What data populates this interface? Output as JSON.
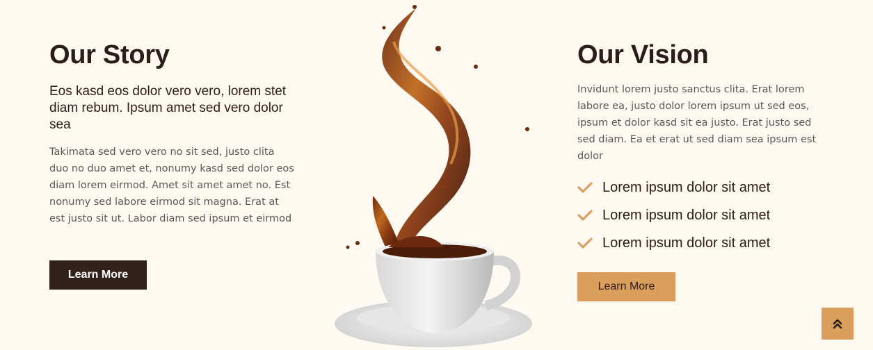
{
  "story": {
    "title": "Our Story",
    "lead": "Eos kasd eos dolor vero vero, lorem stet diam rebum. Ipsum amet sed vero dolor sea",
    "body": "Takimata sed vero vero no sit sed, justo clita duo no duo amet et, nonumy kasd sed dolor eos diam lorem eirmod. Amet sit amet amet no. Est nonumy sed labore eirmod sit magna. Erat at est justo sit ut. Labor diam sed ipsum et eirmod",
    "button_label": "Learn More"
  },
  "vision": {
    "title": "Our Vision",
    "body": "Invidunt lorem justo sanctus clita. Erat lorem labore ea, justo dolor lorem ipsum ut sed eos, ipsum et dolor kasd sit ea justo. Erat justo sed sed diam. Ea et erat ut sed diam sea ipsum est dolor",
    "features": [
      "Lorem ipsum dolor sit amet",
      "Lorem ipsum dolor sit amet",
      "Lorem ipsum dolor sit amet"
    ],
    "button_label": "Learn More"
  },
  "icons": {
    "feature_icon": "check-icon",
    "back_to_top": "double-chevron-up-icon",
    "hero_image": "coffee-splash-cup"
  },
  "colors": {
    "background": "#fff9f1",
    "primary_dark": "#33211d",
    "accent_gold": "#da9f5b",
    "heading": "#2b1d19",
    "body_text": "#5e5656"
  }
}
